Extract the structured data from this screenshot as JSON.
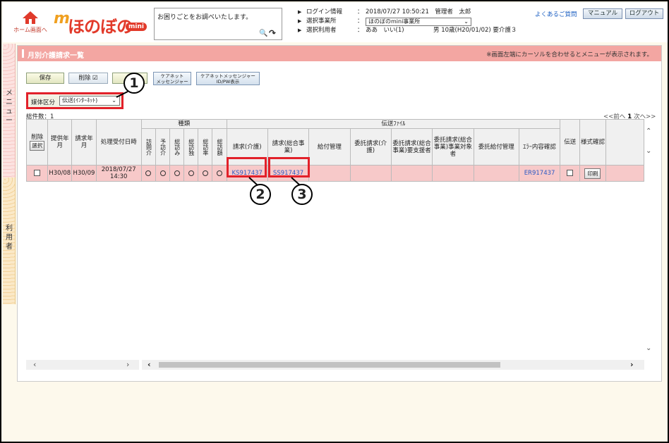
{
  "header": {
    "home_label": "ホーム画面へ",
    "logo_text": "ほのぼの",
    "logo_mini": "mini",
    "search_placeholder": "お困りごとをお調べいたします。",
    "login_label": "ログイン情報",
    "login_value": "2018/07/27 10:50:21　管理者　太郎",
    "office_label": "選択事業所",
    "office_value": "ほのぼのmini事業所",
    "user_label": "選択利用者",
    "user_name": "ああ　いい(1)",
    "user_detail": "男 10歳(H20/01/02) 要介護３",
    "faq": "よくあるご質問",
    "manual": "マニュアル",
    "logout": "ログアウト"
  },
  "side": {
    "menu_label": "メニュー",
    "user_label": "利用者"
  },
  "page": {
    "title": "月別介護請求一覧",
    "note": "※画面左端にカーソルを合わせるとメニューが表示されます。"
  },
  "toolbar": {
    "save": "保存",
    "delete": "削除",
    "tally": "結",
    "cn_msg_line1": "ケアネット",
    "cn_msg_line2": "メッセンジャー",
    "cn_pw_line1": "ケアネットメッセンジャー",
    "cn_pw_line2": "ID/PW表示"
  },
  "filter": {
    "label": "媒体区分",
    "value": "伝送(ｲﾝﾀｰﾈｯﾄ)"
  },
  "callouts": [
    "1",
    "2",
    "3"
  ],
  "list": {
    "total": "総件数：1",
    "pager_prev": "<<前へ",
    "pager_page": "1",
    "pager_next": "次へ>>"
  },
  "table": {
    "group_kind": "種類",
    "group_transfer": "伝送ﾌｧｲﾙ",
    "headers": {
      "delete": "削除",
      "select_btn": "選択",
      "provide": "提供年月",
      "bill": "請求年月",
      "received": "処理受付日時",
      "kinds": [
        "訪問介",
        "予訪介",
        "総訪み",
        "総訪独",
        "総訪率",
        "総訪額"
      ],
      "bill_care": "請求(介護)",
      "bill_general": "請求(総合事業)",
      "benefit": "給付管理",
      "consign_care": "委託請求(介護)",
      "consign_support": "委託請求(総合事業)要支援者",
      "consign_target": "委託請求(総合事業)事業対象者",
      "consign_benefit": "委託給付管理",
      "error": "ｴﾗｰ内容確認",
      "send": "伝送",
      "form": "様式確認"
    },
    "rows": [
      {
        "provide": "H30/08",
        "bill": "H30/09",
        "received_date": "2018/07/27",
        "received_time": "14:30",
        "kinds": [
          "○",
          "○",
          "○",
          "○",
          "○",
          "○"
        ],
        "bill_care": "KS917437",
        "bill_general": "SS917437",
        "error": "ER917437",
        "print": "印刷"
      }
    ]
  }
}
